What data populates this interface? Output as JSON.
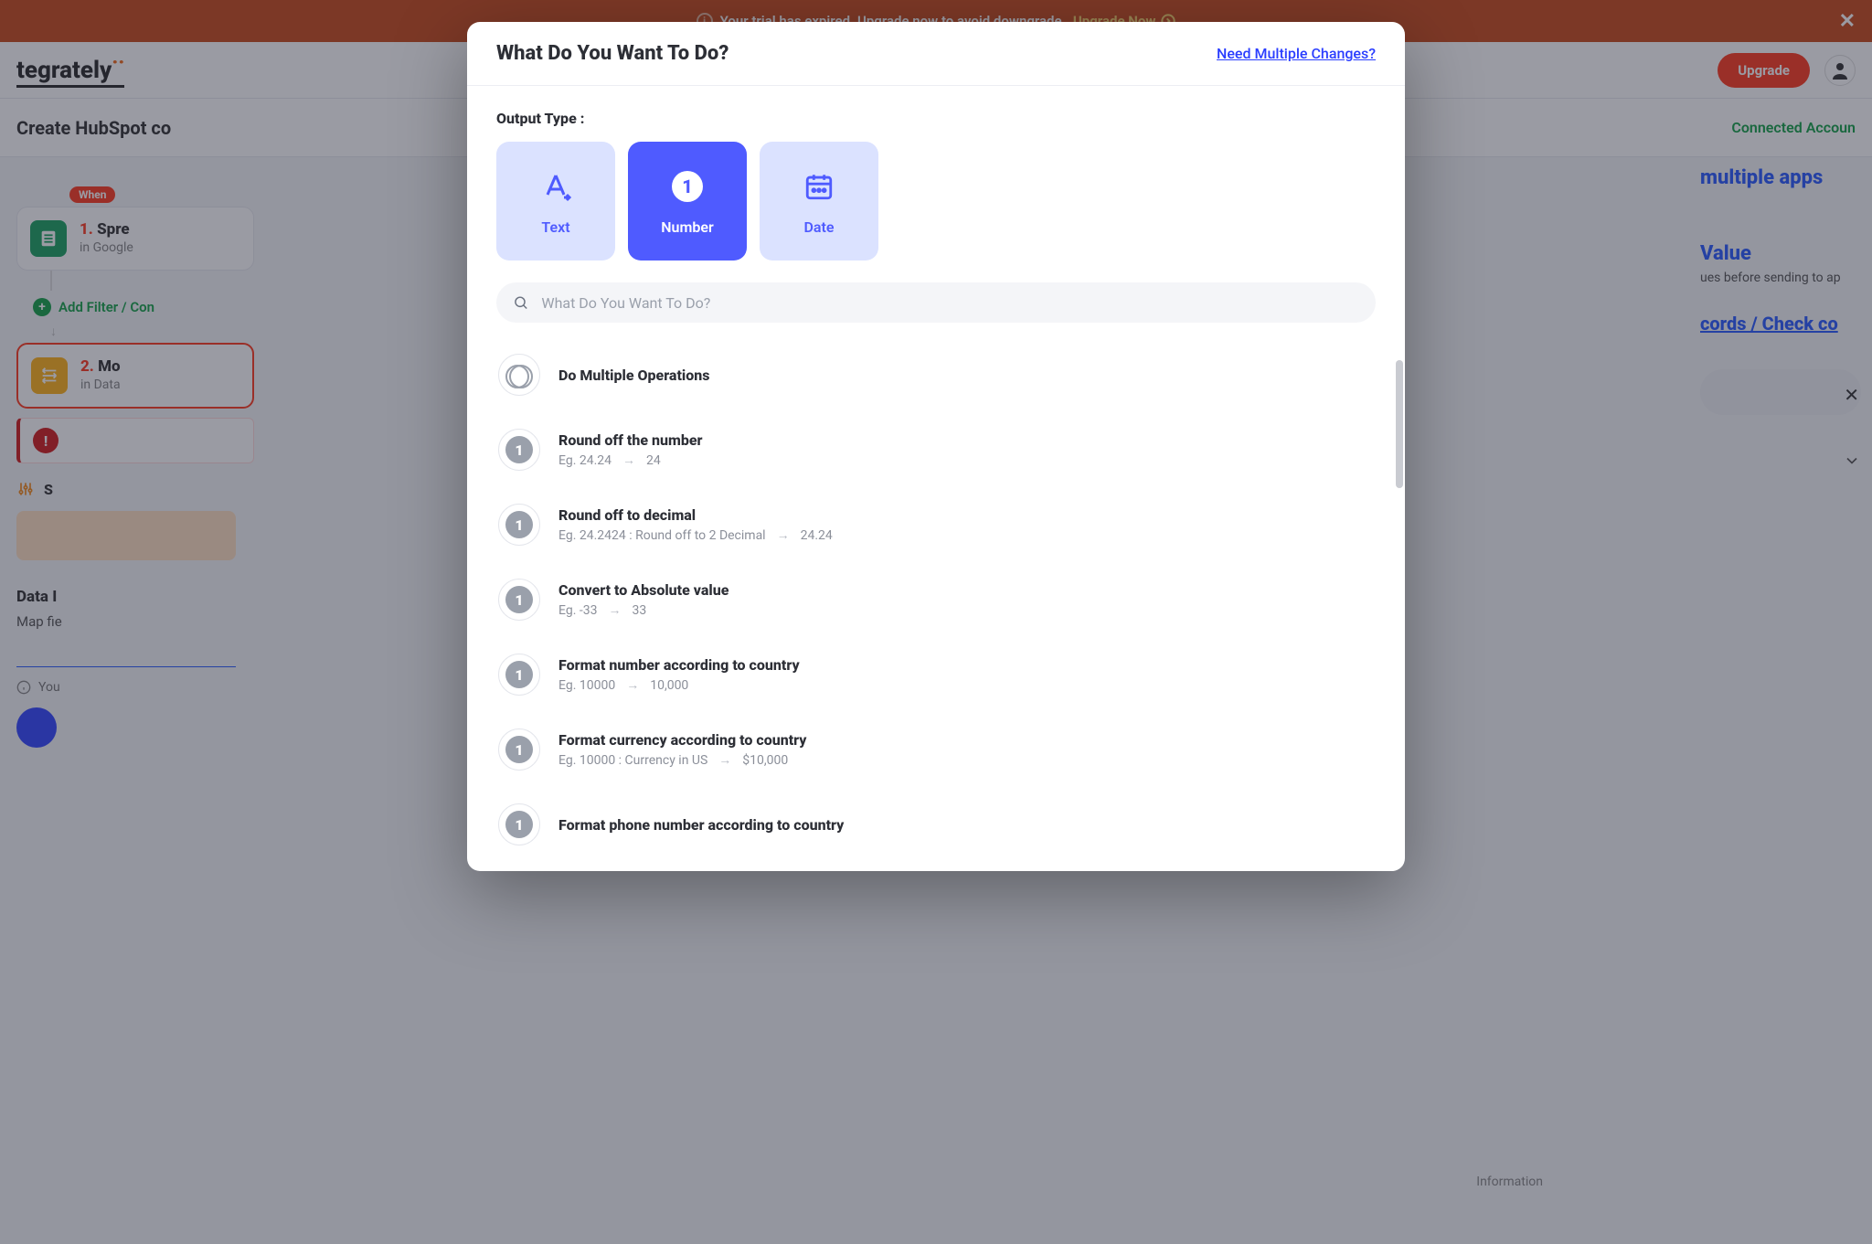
{
  "banner": {
    "text": "Your trial has expired. Upgrade now to avoid downgrade.",
    "cta": "Upgrade Now"
  },
  "header": {
    "logo": "tegrately",
    "upgrade_btn": "Upgrade"
  },
  "subhead": {
    "title": "Create HubSpot co",
    "right_link": "Connected Accoun"
  },
  "flow": {
    "when_badge": "When",
    "step1_num": "1.",
    "step1_title": "Spre",
    "step1_sub": "in Google",
    "add_filter": "Add Filter / Con",
    "step2_num": "2.",
    "step2_title": "Mo",
    "step2_sub": "in Data",
    "setup_label": "S",
    "data_in": "Data I",
    "map_fields": "Map fie",
    "hint": "You"
  },
  "right_panel": {
    "multi_apps": "multiple apps",
    "value": "Value",
    "value_sub": "ues before sending to ap",
    "records": "cords / Check co",
    "info_label": "Information"
  },
  "modal": {
    "title": "What Do You Want To Do?",
    "multi_link": "Need Multiple Changes?",
    "output_label": "Output Type :",
    "types": {
      "text": "Text",
      "number": "Number",
      "date": "Date"
    },
    "search_placeholder": "What Do You Want To Do?",
    "ops": [
      {
        "title": "Do Multiple Operations"
      },
      {
        "title": "Round off the number",
        "eg_in": "Eg. 24.24",
        "eg_out": "24"
      },
      {
        "title": "Round off to decimal",
        "eg_in": "Eg. 24.2424 : Round off to 2 Decimal",
        "eg_out": "24.24"
      },
      {
        "title": "Convert to Absolute value",
        "eg_in": "Eg. -33",
        "eg_out": "33"
      },
      {
        "title": "Format number according to country",
        "eg_in": "Eg. 10000",
        "eg_out": "10,000"
      },
      {
        "title": "Format currency according to country",
        "eg_in": "Eg. 10000 : Currency in US",
        "eg_out": "$10,000"
      },
      {
        "title": "Format phone number according to country"
      }
    ]
  }
}
